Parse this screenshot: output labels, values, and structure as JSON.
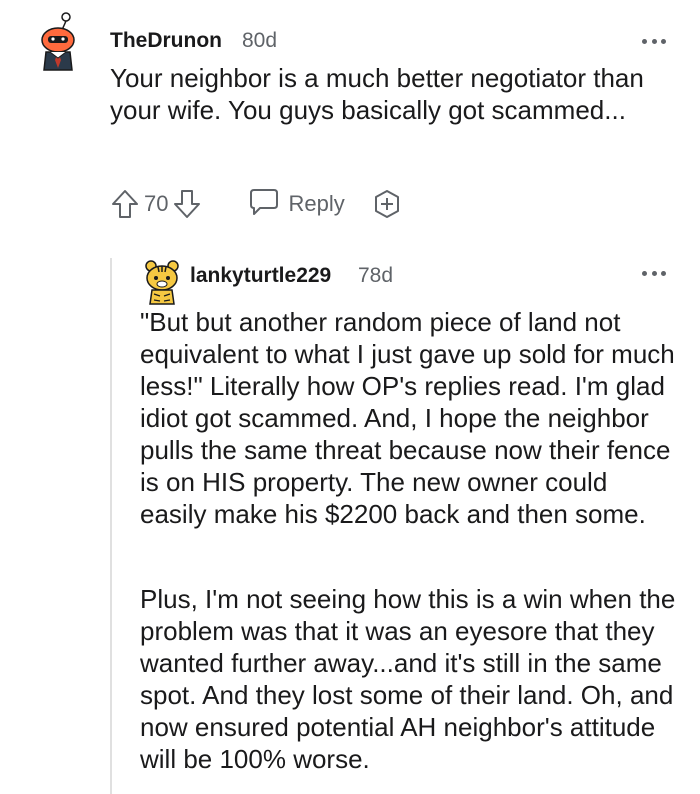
{
  "comment1": {
    "username": "TheDrunon",
    "age": "80d",
    "body": "Your neighbor is a much better negotiator than your wife. You guys basically got scammed...",
    "vote_count": "70",
    "reply_label": "Reply",
    "avatar_icon": "snoo-avatar-icon",
    "upvote_icon": "upvote-arrow-icon",
    "downvote_icon": "downvote-arrow-icon",
    "reply_icon": "speech-bubble-icon",
    "award_icon": "award-plus-icon",
    "more_icon": "more-options-icon"
  },
  "comment2": {
    "username": "lankyturtle229",
    "age": "78d",
    "paragraph1": "\"But but another random piece of land not equivalent to what I just gave up sold for much less!\" Literally how OP's replies read. I'm glad idiot got scammed. And, I hope the neighbor pulls the same threat because now their fence is on HIS property. The new owner could easily make his $2200 back and then some.",
    "paragraph2": "Plus, I'm not seeing how this is a win when the problem was that it was an eyesore that they wanted further away...and it's still in the same spot. And they lost some of their land. Oh, and now ensured potential AH neighbor's attitude will be 100% worse.",
    "avatar_icon": "tiger-snoo-avatar-icon",
    "more_icon": "more-options-icon"
  },
  "colors": {
    "text_primary": "#1a1a1b",
    "text_secondary": "#5f6368",
    "thread_line": "#e0e0e0",
    "background": "#ffffff"
  }
}
